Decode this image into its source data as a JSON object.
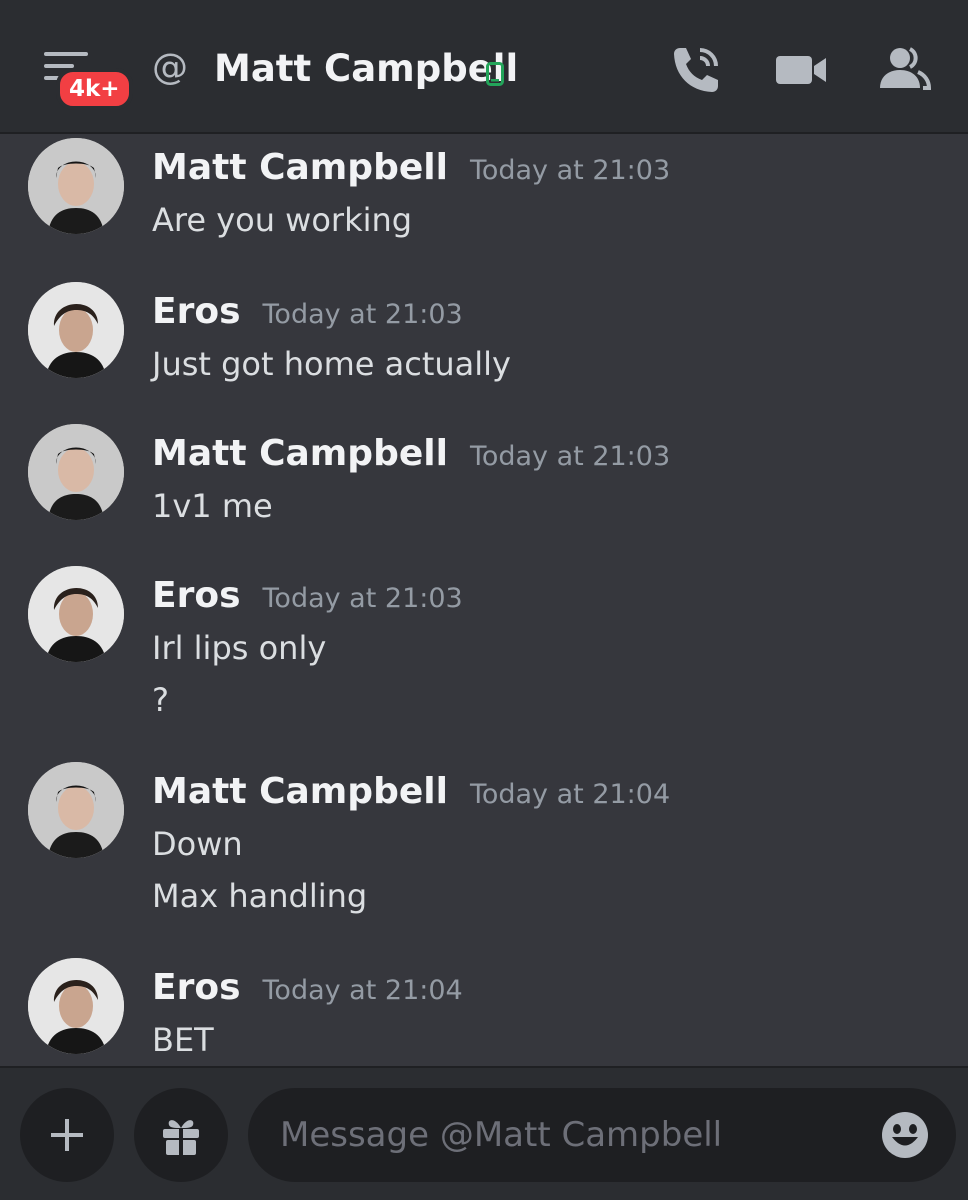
{
  "header": {
    "unread_badge": "4k+",
    "at_symbol": "@",
    "title": "Matt Campbell",
    "status_icon": "mobile-online-icon",
    "status_color": "#23a55a",
    "icons": [
      "call-icon",
      "video-icon",
      "members-icon"
    ]
  },
  "messages": [
    {
      "author": "Matt Campbell",
      "time": "Today at 21:03",
      "lines": [
        "Are you working"
      ]
    },
    {
      "author": "Eros",
      "time": "Today at 21:03",
      "lines": [
        "Just got home actually"
      ]
    },
    {
      "author": "Matt Campbell",
      "time": "Today at 21:03",
      "lines": [
        "1v1 me"
      ]
    },
    {
      "author": "Eros",
      "time": "Today at 21:03",
      "lines": [
        "Irl lips only",
        "?"
      ]
    },
    {
      "author": "Matt Campbell",
      "time": "Today at 21:04",
      "lines": [
        "Down",
        "Max handling"
      ]
    },
    {
      "author": "Eros",
      "time": "Today at 21:04",
      "lines": [
        "BET"
      ]
    }
  ],
  "composer": {
    "add_icon": "plus-icon",
    "gift_icon": "gift-icon",
    "placeholder": "Message @Matt Campbell",
    "emoji_icon": "emoji-icon"
  }
}
